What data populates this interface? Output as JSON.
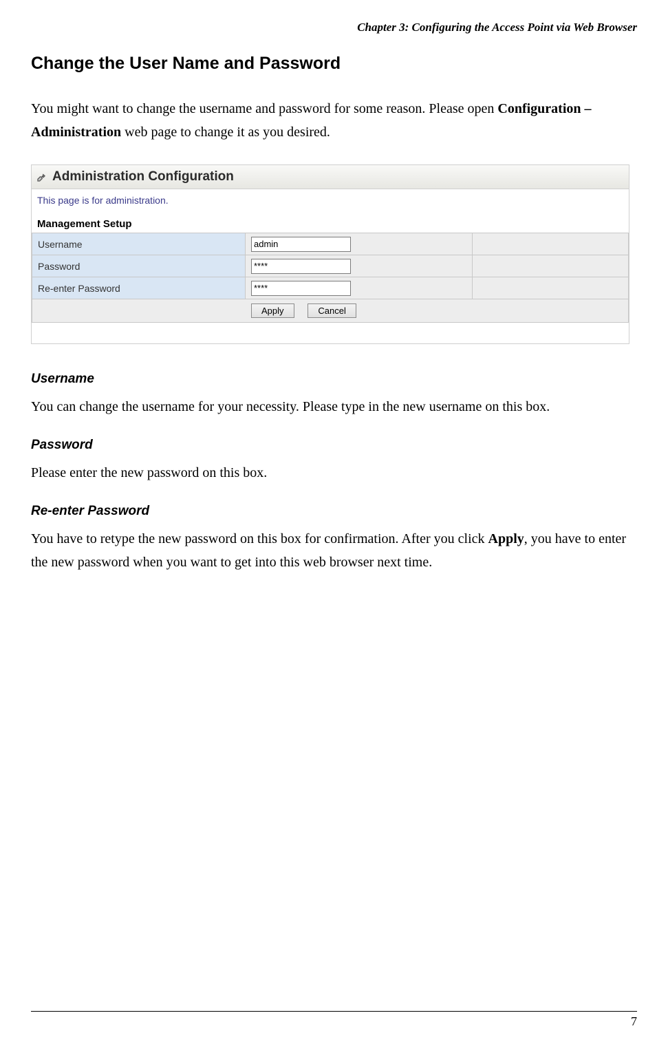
{
  "chapter_header": "Chapter 3: Configuring the Access Point via Web Browser",
  "title": "Change the User Name and Password",
  "intro_pre": "You might want to change the username and password for some reason. Please open ",
  "intro_bold": "Configuration – Administration",
  "intro_post": " web page to change it as you desired.",
  "screenshot": {
    "heading": "Administration Configuration",
    "note": "This page is for administration.",
    "section": "Management Setup",
    "rows": {
      "username_label": "Username",
      "username_value": "admin",
      "password_label": "Password",
      "password_value": "****",
      "reenter_label": "Re-enter Password",
      "reenter_value": "****"
    },
    "buttons": {
      "apply": "Apply",
      "cancel": "Cancel"
    }
  },
  "sections": {
    "username": {
      "heading": "Username",
      "text": "You can change the username for your necessity. Please type in the new username on this box."
    },
    "password": {
      "heading": "Password",
      "text": "Please enter the new password on this box."
    },
    "reenter": {
      "heading": "Re-enter Password",
      "text_pre": "You have to retype the new password on this box for confirmation. After you click ",
      "text_bold": "Apply",
      "text_post": ", you have to enter the new password when you want to get into this web browser next time."
    }
  },
  "page_number": "7"
}
